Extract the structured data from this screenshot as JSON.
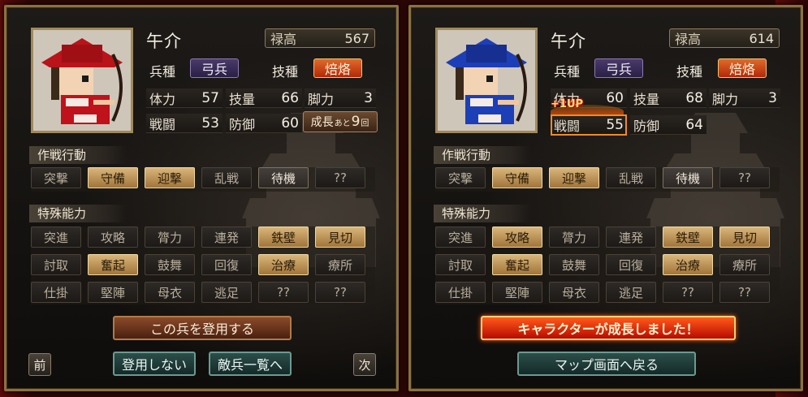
{
  "left": {
    "name": "午介",
    "stipend_label": "禄高",
    "stipend_value": "567",
    "unit_type_label": "兵種",
    "unit_type_value": "弓兵",
    "skill_label": "技種",
    "skill_value": "焙烙",
    "stats": {
      "stamina_label": "体力",
      "stamina": "57",
      "technique_label": "技量",
      "technique": "66",
      "legs_label": "脚力",
      "legs": "3",
      "combat_label": "戦闘",
      "combat": "53",
      "defense_label": "防御",
      "defense": "60"
    },
    "growth_a": "成長",
    "growth_b": "あと",
    "growth_num": "9",
    "growth_c": "回",
    "tactics_title": "作戦行動",
    "tactics": [
      "突撃",
      "守備",
      "迎撃",
      "乱戦",
      "待機",
      "??"
    ],
    "special_title": "特殊能力",
    "specials": [
      "突進",
      "攻略",
      "膂力",
      "連発",
      "鉄壁",
      "見切",
      "討取",
      "奮起",
      "鼓舞",
      "回復",
      "治療",
      "療所",
      "仕掛",
      "堅陣",
      "母衣",
      "逃足",
      "??",
      "??"
    ],
    "recruit_button": "この兵を登用する",
    "prev_button": "前",
    "decline_button": "登用しない",
    "enemy_list_button": "敵兵一覧へ",
    "next_button": "次"
  },
  "right": {
    "name": "午介",
    "stipend_label": "禄高",
    "stipend_value": "614",
    "unit_type_label": "兵種",
    "unit_type_value": "弓兵",
    "skill_label": "技種",
    "skill_value": "焙烙",
    "stats": {
      "stamina_label": "体力",
      "stamina": "60",
      "technique_label": "技量",
      "technique": "68",
      "legs_label": "脚力",
      "legs": "3",
      "combat_label": "戦闘",
      "combat": "55",
      "defense_label": "防御",
      "defense": "64"
    },
    "levelup_text": "+1UP",
    "tactics_title": "作戦行動",
    "tactics": [
      "突撃",
      "守備",
      "迎撃",
      "乱戦",
      "待機",
      "??"
    ],
    "special_title": "特殊能力",
    "specials": [
      "突進",
      "攻略",
      "膂力",
      "連発",
      "鉄壁",
      "見切",
      "討取",
      "奮起",
      "鼓舞",
      "回復",
      "治療",
      "療所",
      "仕掛",
      "堅陣",
      "母衣",
      "逃足",
      "??",
      "??"
    ],
    "grown_banner": "キャラクターが成長しました！",
    "back_to_map_button": "マップ画面へ戻る"
  },
  "colors": {
    "chip_active": "#d9b57a",
    "chip_inactive": "#2e2a26",
    "hat_left": "#b8141a",
    "hat_right": "#1c3fb8",
    "accent_red": "#e06a2a"
  },
  "states": {
    "left_tactics": [
      "off",
      "on",
      "on",
      "off",
      "mid",
      "off"
    ],
    "left_specials": [
      "off",
      "off",
      "off",
      "off",
      "on",
      "on",
      "off",
      "on",
      "off",
      "off",
      "on",
      "off",
      "off",
      "off",
      "off",
      "off",
      "off",
      "off"
    ],
    "right_tactics": [
      "off",
      "on",
      "on",
      "off",
      "mid",
      "off"
    ],
    "right_specials": [
      "off",
      "on",
      "off",
      "off",
      "on",
      "on",
      "off",
      "on",
      "off",
      "off",
      "on",
      "off",
      "off",
      "off",
      "off",
      "off",
      "off",
      "off"
    ]
  }
}
